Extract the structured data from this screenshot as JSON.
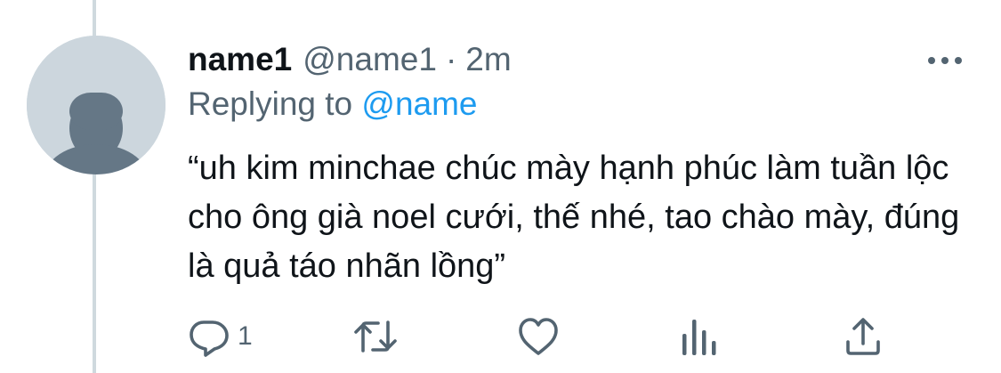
{
  "tweet": {
    "display_name": "name1",
    "handle": "@name1",
    "separator": "·",
    "time": "2m",
    "replying_prefix": "Replying to",
    "replying_to": "@name",
    "text": "“uh kim minchae chúc mày hạnh phúc làm tuần lộc cho ông già noel cưới, thế nhé, tao chào mày, đúng là quả táo nhãn lồng”",
    "reply_count": "1"
  },
  "icons": {
    "avatar": "default-avatar-icon",
    "more": "more-options-icon",
    "reply": "reply-icon",
    "retweet": "retweet-icon",
    "like": "heart-icon",
    "analytics": "analytics-icon",
    "share": "share-icon"
  },
  "colors": {
    "text": "#0f1419",
    "secondary": "#536471",
    "accent": "#1d9bf0",
    "avatar_bg": "#ccd6dd",
    "avatar_fg": "#657786",
    "thread_line": "#cfd9de"
  }
}
